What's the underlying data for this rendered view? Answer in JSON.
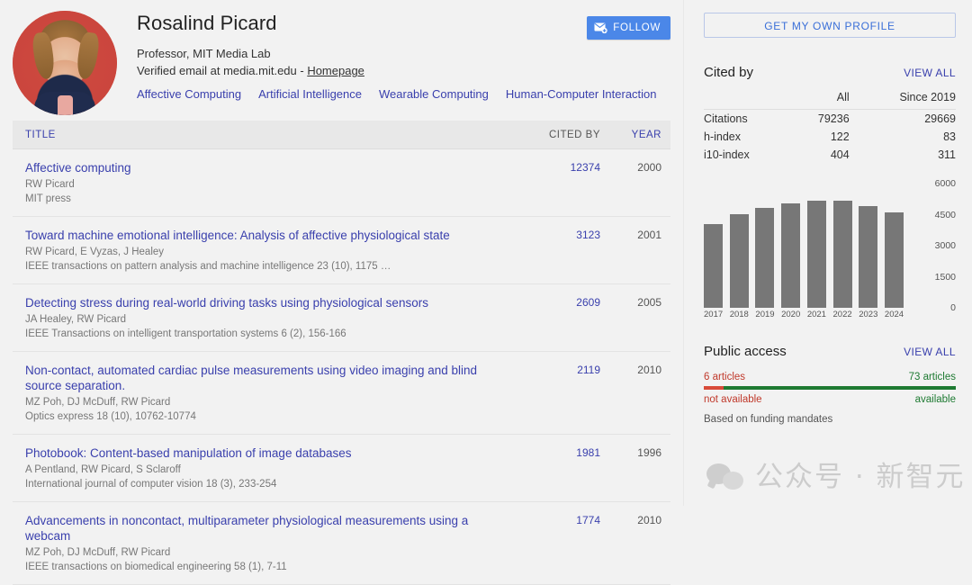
{
  "profile": {
    "name": "Rosalind Picard",
    "affiliation": "Professor, MIT Media Lab",
    "email_text": "Verified email at media.mit.edu - ",
    "homepage_label": "Homepage",
    "interests": [
      "Affective Computing",
      "Artificial Intelligence",
      "Wearable Computing",
      "Human-Computer Interaction"
    ],
    "follow_label": "FOLLOW",
    "follow_icon": "envelope-plus-icon",
    "avatar_name": "profile-photo"
  },
  "publications": {
    "headers": {
      "title": "TITLE",
      "cited_by": "CITED BY",
      "year": "YEAR"
    },
    "rows": [
      {
        "title": "Affective computing",
        "authors": "RW Picard",
        "venue": "MIT press",
        "cited_by": "12374",
        "year": "2000"
      },
      {
        "title": "Toward machine emotional intelligence: Analysis of affective physiological state",
        "authors": "RW Picard, E Vyzas, J Healey",
        "venue": "IEEE transactions on pattern analysis and machine intelligence 23 (10), 1175 …",
        "cited_by": "3123",
        "year": "2001"
      },
      {
        "title": "Detecting stress during real-world driving tasks using physiological sensors",
        "authors": "JA Healey, RW Picard",
        "venue": "IEEE Transactions on intelligent transportation systems 6 (2), 156-166",
        "cited_by": "2609",
        "year": "2005"
      },
      {
        "title": "Non-contact, automated cardiac pulse measurements using video imaging and blind source separation.",
        "authors": "MZ Poh, DJ McDuff, RW Picard",
        "venue": "Optics express 18 (10), 10762-10774",
        "cited_by": "2119",
        "year": "2010"
      },
      {
        "title": "Photobook: Content-based manipulation of image databases",
        "authors": "A Pentland, RW Picard, S Sclaroff",
        "venue": "International journal of computer vision 18 (3), 233-254",
        "cited_by": "1981",
        "year": "1996"
      },
      {
        "title": "Advancements in noncontact, multiparameter physiological measurements using a webcam",
        "authors": "MZ Poh, DJ McDuff, RW Picard",
        "venue": "IEEE transactions on biomedical engineering 58 (1), 7-11",
        "cited_by": "1774",
        "year": "2010"
      }
    ]
  },
  "sidebar": {
    "get_own_profile_label": "GET MY OWN PROFILE",
    "cited_by": {
      "title": "Cited by",
      "view_all_label": "VIEW ALL",
      "col_all": "All",
      "col_since": "Since 2019",
      "metrics": [
        {
          "label": "Citations",
          "all": "79236",
          "since": "29669"
        },
        {
          "label": "h-index",
          "all": "122",
          "since": "83"
        },
        {
          "label": "i10-index",
          "all": "404",
          "since": "311"
        }
      ]
    },
    "public_access": {
      "title": "Public access",
      "view_all_label": "VIEW ALL",
      "not_available_count": "6 articles",
      "available_count": "73 articles",
      "not_available_label": "not available",
      "available_label": "available",
      "note": "Based on funding mandates",
      "not_available_color": "#c0392b",
      "available_color": "#1e7a32",
      "not_available_pct": 8,
      "available_pct": 92
    }
  },
  "chart_data": {
    "type": "bar",
    "title": "",
    "categories": [
      "2017",
      "2018",
      "2019",
      "2020",
      "2021",
      "2022",
      "2023",
      "2024"
    ],
    "values": [
      4043,
      4520,
      4826,
      5044,
      5174,
      5174,
      4913,
      4608
    ],
    "yticks": [
      0,
      1500,
      3000,
      4500,
      6000
    ],
    "ylim": [
      0,
      6000
    ],
    "xlabel": "",
    "ylabel": "",
    "grid": false,
    "legend": false,
    "bar_color": "#777777"
  },
  "watermark": {
    "text": "公众号 · 新智元",
    "logo": "wechat-icon"
  },
  "theme": {
    "link": "#3a40ad",
    "accent_blue": "#4b87e8",
    "background": "#f2f2f2"
  }
}
